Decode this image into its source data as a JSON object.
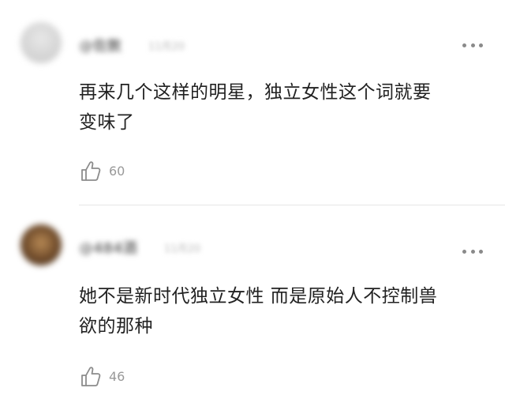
{
  "comments": [
    {
      "username": "@佐敦",
      "timestamp": "11月20",
      "text_lines": [
        "再来几个这样的明星，独立女性这个词就要",
        "变味了"
      ],
      "likes": "60",
      "avatar_color": "#d6d6d6"
    },
    {
      "username": "@484酒",
      "timestamp": "11月20",
      "text_lines": [
        "她不是新时代独立女性 而是原始人不控制兽",
        "欲的那种"
      ],
      "likes": "46",
      "avatar_color": "#6e4a2a"
    }
  ],
  "icons": {
    "more": "more-dots-icon",
    "like": "thumbs-up-icon"
  },
  "colors": {
    "text": "#222222",
    "meta": "#999999",
    "divider": "#e6e6e6"
  }
}
